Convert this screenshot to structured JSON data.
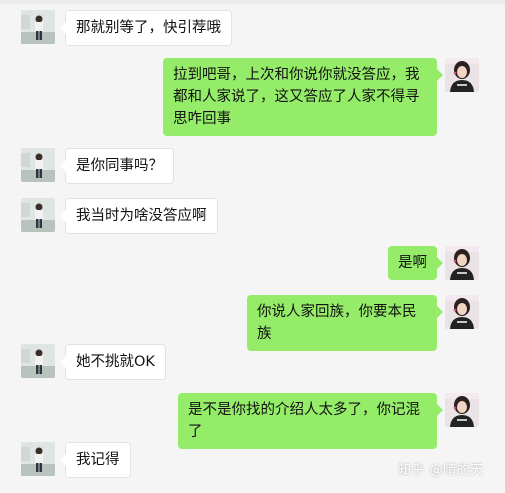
{
  "messages": [
    {
      "side": "left",
      "text": "那就别等了，快引荐哦"
    },
    {
      "side": "right",
      "text": "拉到吧哥，上次和你说你就没答应，我都和人家说了，这又答应了人家不得寻思咋回事"
    },
    {
      "side": "left",
      "text": "是你同事吗？"
    },
    {
      "side": "left",
      "text": "我当时为啥没答应啊"
    },
    {
      "side": "right",
      "text": "是啊"
    },
    {
      "side": "right",
      "text": "你说人家回族，你要本民族"
    },
    {
      "side": "left",
      "text": "她不挑就OK"
    },
    {
      "side": "right",
      "text": "是不是你找的介绍人太多了，你记混了"
    },
    {
      "side": "left",
      "text": "我记得"
    }
  ],
  "watermark": "知乎 @晴的天",
  "colors": {
    "background": "#f5f5f5",
    "sent_bubble": "#95ec69",
    "received_bubble": "#ffffff"
  }
}
